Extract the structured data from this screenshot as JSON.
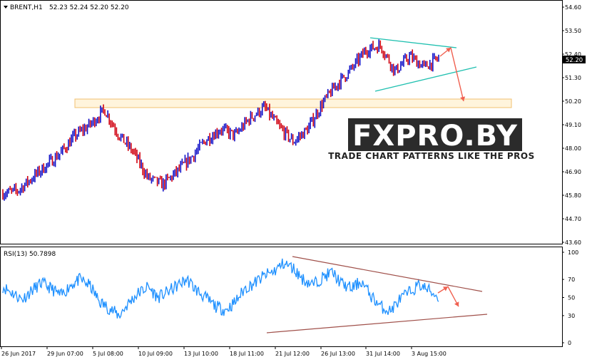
{
  "header": {
    "symbol_label": "BRENT,H1",
    "ohlc_label": "52.23 52.24 52.20 52.20"
  },
  "rsi_panel": {
    "label": "RSI(13) 50.7898"
  },
  "watermark": {
    "logo_text": "FXPRO.BY",
    "tagline": "TRADE CHART PATTERNS LIKE THE PROS"
  },
  "colors": {
    "bull_candle": "#1010c8",
    "bear_candle": "#d00010",
    "rsi_line": "#1e90ff",
    "triangle_price": "#20c0b0",
    "triangle_rsi": "#a0504a",
    "forecast_arrow": "#f06050",
    "support_zone_border": "#f0c070",
    "support_zone_fill": "#fff4dc",
    "current_price_box": "#000000"
  },
  "chart_data": [
    {
      "type": "candlestick",
      "symbol": "BRENT",
      "timeframe": "H1",
      "yticks": [
        "54.60",
        "53.50",
        "52.40",
        "51.30",
        "50.20",
        "49.10",
        "48.00",
        "46.90",
        "45.80",
        "44.70",
        "43.60"
      ],
      "ylim": [
        43.6,
        54.6
      ],
      "xticks": [
        "26 Jun 2017",
        "29 Jun 07:00",
        "5 Jul 08:00",
        "10 Jul 09:00",
        "13 Jul 10:00",
        "18 Jul 11:00",
        "21 Jul 12:00",
        "26 Jul 13:00",
        "31 Jul 14:00",
        "3 Aug 15:00"
      ],
      "current_price": "52.20",
      "close_path": [
        [
          "26 Jun 2017",
          45.9
        ],
        [
          "27 Jun 2017",
          46.0
        ],
        [
          "28 Jun 2017",
          46.6
        ],
        [
          "29 Jun 07:00",
          47.2
        ],
        [
          "30 Jun 2017",
          47.8
        ],
        [
          "3 Jul 2017",
          48.6
        ],
        [
          "4 Jul 2017",
          49.1
        ],
        [
          "5 Jul 08:00",
          49.8
        ],
        [
          "5 Jul 2017",
          48.6
        ],
        [
          "6 Jul 2017",
          47.8
        ],
        [
          "7 Jul 2017",
          46.6
        ],
        [
          "10 Jul 09:00",
          46.3
        ],
        [
          "11 Jul 2017",
          46.9
        ],
        [
          "12 Jul 2017",
          47.6
        ],
        [
          "13 Jul 10:00",
          48.4
        ],
        [
          "14 Jul 2017",
          48.9
        ],
        [
          "17 Jul 2017",
          48.6
        ],
        [
          "18 Jul 11:00",
          49.4
        ],
        [
          "19 Jul 2017",
          49.9
        ],
        [
          "20 Jul 2017",
          49.0
        ],
        [
          "21 Jul 12:00",
          48.3
        ],
        [
          "24 Jul 2017",
          48.9
        ],
        [
          "25 Jul 2017",
          50.1
        ],
        [
          "26 Jul 13:00",
          51.0
        ],
        [
          "27 Jul 2017",
          51.7
        ],
        [
          "28 Jul 2017",
          52.6
        ],
        [
          "31 Jul 14:00",
          52.8
        ],
        [
          "1 Aug 2017",
          51.6
        ],
        [
          "2 Aug 2017",
          52.3
        ],
        [
          "3 Aug 15:00",
          51.8
        ],
        [
          "4 Aug 2017",
          52.2
        ]
      ],
      "support_zone": [
        49.9,
        50.3
      ],
      "forecast_path": [
        [
          0,
          52.3
        ],
        [
          1,
          52.7
        ],
        [
          2,
          50.2
        ]
      ]
    },
    {
      "type": "line",
      "indicator": "RSI(13)",
      "current_value": 50.7898,
      "yticks": [
        "100",
        "70",
        "50",
        "30",
        "0"
      ],
      "ylim": [
        0,
        100
      ],
      "series": [
        {
          "values": [
            62,
            55,
            48,
            58,
            66,
            60,
            52,
            64,
            70,
            63,
            45,
            38,
            30,
            44,
            55,
            62,
            50,
            56,
            63,
            70,
            58,
            49,
            40,
            36,
            45,
            60,
            66,
            74,
            79,
            88,
            82,
            70,
            64,
            72,
            78,
            65,
            60,
            68,
            52,
            40,
            35,
            48,
            56,
            64,
            58,
            50
          ]
        }
      ],
      "forecast_path": [
        [
          0,
          55
        ],
        [
          1,
          62
        ],
        [
          2,
          40
        ]
      ]
    }
  ]
}
